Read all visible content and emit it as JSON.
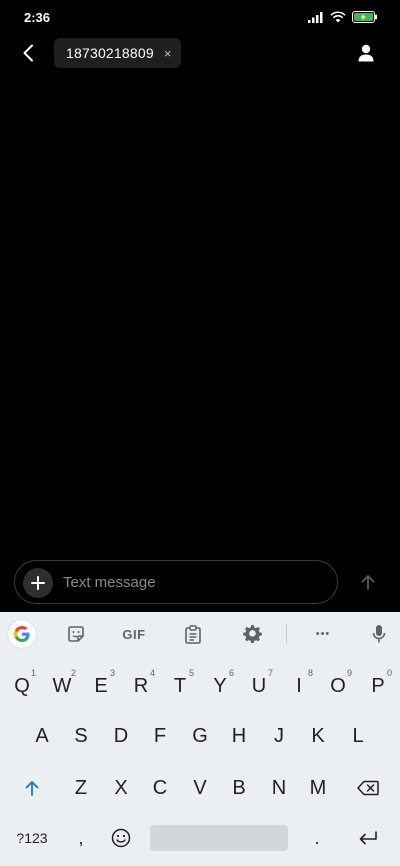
{
  "status": {
    "time": "2:36",
    "signal_icon": "signal-icon",
    "wifi_icon": "wifi-icon",
    "battery_icon": "battery-charging-icon",
    "battery_color": "#4caf50"
  },
  "header": {
    "back_icon": "back-arrow-icon",
    "recipient": "18730218809",
    "remove_glyph": "×",
    "contact_icon": "contact-icon"
  },
  "compose": {
    "placeholder": "Text message",
    "add_glyph": "+",
    "send_icon": "send-arrow-icon"
  },
  "keyboard": {
    "toolbar": {
      "google_icon": "google-g-icon",
      "sticker_icon": "sticker-icon",
      "gif_label": "GIF",
      "clipboard_icon": "clipboard-icon",
      "settings_icon": "gear-icon",
      "more_glyph": "•••",
      "mic_icon": "mic-icon"
    },
    "row1": [
      {
        "key": "Q",
        "hint": "1"
      },
      {
        "key": "W",
        "hint": "2"
      },
      {
        "key": "E",
        "hint": "3"
      },
      {
        "key": "R",
        "hint": "4"
      },
      {
        "key": "T",
        "hint": "5"
      },
      {
        "key": "Y",
        "hint": "6"
      },
      {
        "key": "U",
        "hint": "7"
      },
      {
        "key": "I",
        "hint": "8"
      },
      {
        "key": "O",
        "hint": "9"
      },
      {
        "key": "P",
        "hint": "0"
      }
    ],
    "row2": [
      "A",
      "S",
      "D",
      "F",
      "G",
      "H",
      "J",
      "K",
      "L"
    ],
    "row3": [
      "Z",
      "X",
      "C",
      "V",
      "B",
      "N",
      "M"
    ],
    "row4": {
      "symbols": "?123",
      "comma": ",",
      "period": "."
    },
    "accent_color": "#1a73e8"
  }
}
